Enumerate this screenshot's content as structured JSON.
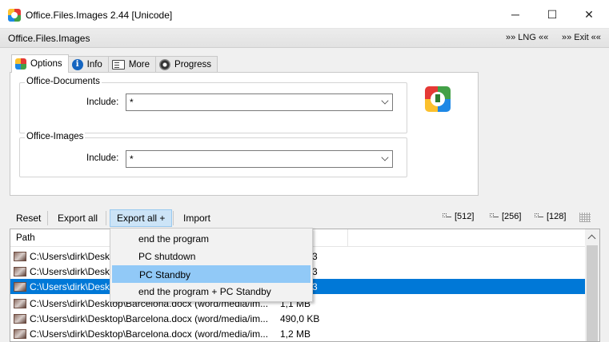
{
  "window": {
    "title": "Office.Files.Images 2.44 [Unicode]",
    "minimize": "─",
    "maximize": "☐",
    "close": "✕"
  },
  "menubar": {
    "app_name": "Office.Files.Images",
    "lng": "»» LNG ««",
    "exit": "»» Exit ««"
  },
  "tabs": [
    {
      "label": "Options",
      "icon": "options-icon",
      "active": true
    },
    {
      "label": "Info",
      "icon": "info-icon"
    },
    {
      "label": "More",
      "icon": "more-icon"
    },
    {
      "label": "Progress",
      "icon": "progress-icon"
    }
  ],
  "office_documents": {
    "group_label": "Office-Documents",
    "include_label": "Include:",
    "include_value": "*"
  },
  "office_images": {
    "group_label": "Office-Images",
    "include_label": "Include:",
    "include_value": "*"
  },
  "toolbar": {
    "reset": "Reset",
    "export_all": "Export all",
    "export_all_plus": "Export all +",
    "import": "Import",
    "size_512": "[512]",
    "size_256": "[256]",
    "size_128": "[128]"
  },
  "list": {
    "column_path": "Path",
    "rows": [
      {
        "path": "C:\\Users\\dirk\\Deskt",
        "size": "3"
      },
      {
        "path": "C:\\Users\\dirk\\Deskt",
        "size": "3"
      },
      {
        "path": "C:\\Users\\dirk\\Deskt",
        "size": "3",
        "selected": true
      },
      {
        "path": "C:\\Users\\dirk\\Desktop\\Barcelona.docx (word/media/im...",
        "size": "1,1 MB"
      },
      {
        "path": "C:\\Users\\dirk\\Desktop\\Barcelona.docx (word/media/im...",
        "size": "490,0 KB"
      },
      {
        "path": "C:\\Users\\dirk\\Desktop\\Barcelona.docx (word/media/im...",
        "size": "1,2 MB"
      }
    ]
  },
  "dropdown": {
    "items": [
      "end the program",
      "PC shutdown",
      "PC Standby",
      "end the program + PC Standby"
    ],
    "highlighted_index": 2
  },
  "colors": {
    "selection": "#0078d7",
    "menu_hover": "#91c9f7",
    "pressed_button": "#cce4f7"
  }
}
